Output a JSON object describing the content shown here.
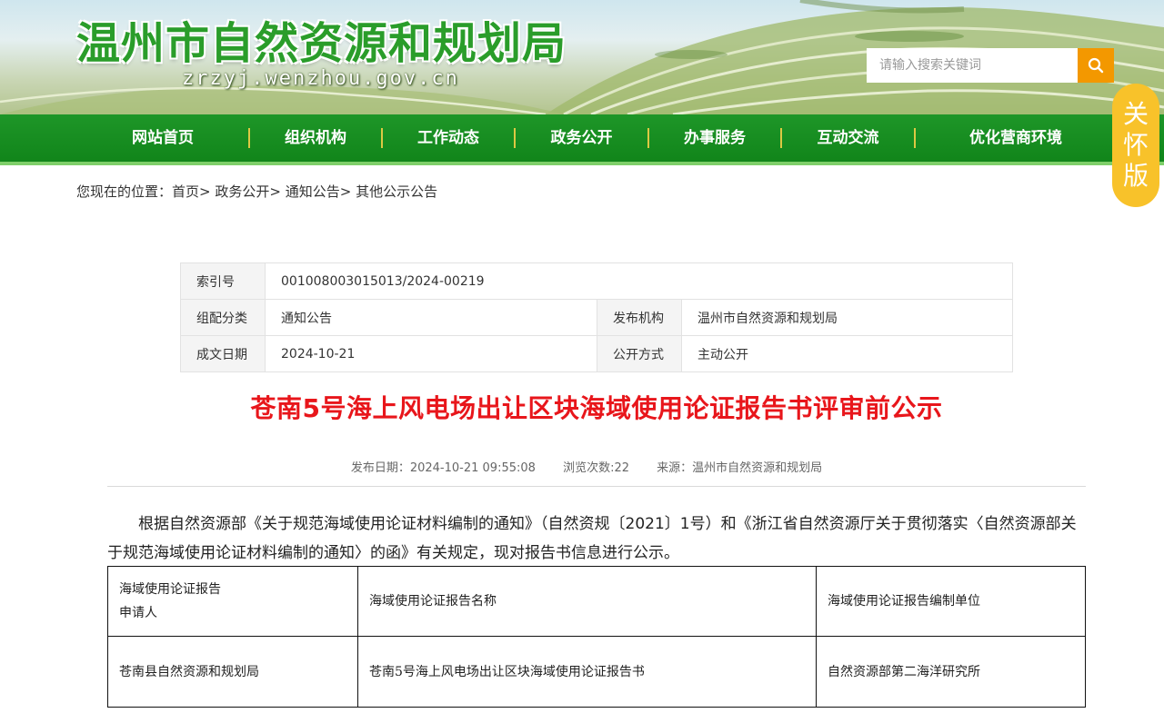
{
  "header": {
    "site_title": "温州市自然资源和规划局",
    "site_domain": "zrzyj.wenzhou.gov.cn",
    "search_placeholder": "请输入搜索关键词",
    "search_icon": "search-icon"
  },
  "nav": {
    "items": [
      "网站首页",
      "组织机构",
      "工作动态",
      "政务公开",
      "办事服务",
      "互动交流",
      "优化营商环境"
    ]
  },
  "care_mode": [
    "关",
    "怀",
    "版"
  ],
  "breadcrumb": {
    "prefix": "您现在的位置：",
    "items": [
      "首页",
      "政务公开",
      "通知公告",
      "其他公示公告"
    ],
    "separator": ">"
  },
  "meta": {
    "index_label": "索引号",
    "index_value": "001008003015013/2024-00219",
    "category_label": "组配分类",
    "category_value": "通知公告",
    "publisher_label": "发布机构",
    "publisher_value": "温州市自然资源和规划局",
    "date_label": "成文日期",
    "date_value": "2024-10-21",
    "open_label": "公开方式",
    "open_value": "主动公开"
  },
  "article": {
    "title": "苍南5号海上风电场出让区块海域使用论证报告书评审前公示",
    "publish_date": "发布日期：2024-10-21 09:55:08",
    "views": "浏览次数:22",
    "source": "来源：温州市自然资源和规划局",
    "paragraph": "根据自然资源部《关于规范海域使用论证材料编制的通知》（自然资规〔2021〕1号）和《浙江省自然资源厅关于贯彻落实〈自然资源部关于规范海域使用论证材料编制的通知〉的函》有关规定，现对报告书信息进行公示。"
  },
  "report_table": {
    "headers": [
      "海域使用论证报告申请人",
      "海域使用论证报告名称",
      "海域使用论证报告编制单位"
    ],
    "header_line1": "海域使用论证报告",
    "header_line2": "申请人",
    "rows": [
      [
        "苍南县自然资源和规划局",
        "苍南5号海上风电场出让区块海域使用论证报告书",
        "自然资源部第二海洋研究所"
      ]
    ]
  },
  "colors": {
    "nav_green": "#11851a",
    "title_red": "#e8161b",
    "search_orange": "#f39800",
    "care_yellow": "#f8c22a"
  }
}
